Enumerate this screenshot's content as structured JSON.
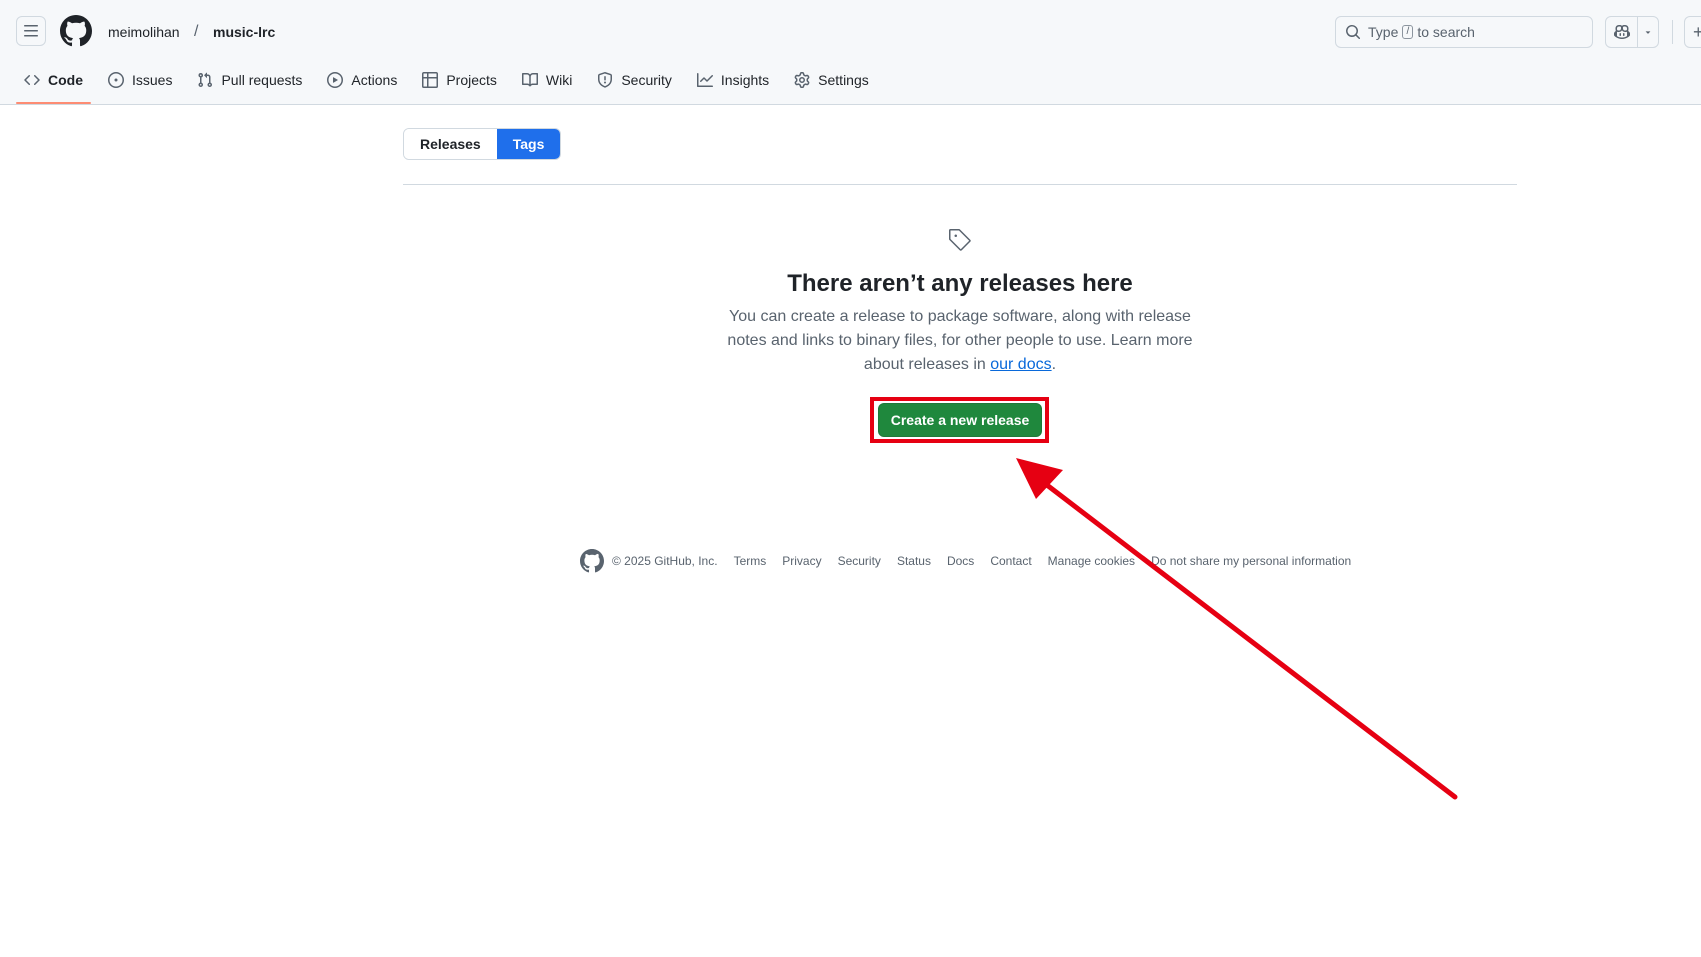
{
  "header": {
    "owner": "meimolihan",
    "separator": "/",
    "repo": "music-lrc",
    "search": {
      "prefix": "Type",
      "key": "/",
      "suffix": "to search"
    },
    "plus": "+"
  },
  "repo_nav": [
    {
      "label": "Code",
      "icon": "code-icon",
      "selected": true
    },
    {
      "label": "Issues",
      "icon": "issue-opened-icon"
    },
    {
      "label": "Pull requests",
      "icon": "git-pull-request-icon"
    },
    {
      "label": "Actions",
      "icon": "play-icon"
    },
    {
      "label": "Projects",
      "icon": "table-icon"
    },
    {
      "label": "Wiki",
      "icon": "book-icon"
    },
    {
      "label": "Security",
      "icon": "shield-icon"
    },
    {
      "label": "Insights",
      "icon": "graph-icon"
    },
    {
      "label": "Settings",
      "icon": "gear-icon"
    }
  ],
  "tabs": {
    "releases": "Releases",
    "tags": "Tags",
    "active": "Tags"
  },
  "blankslate": {
    "icon": "tag-icon",
    "title": "There aren’t any releases here",
    "text_line1": "You can create a release to package software, along with release",
    "text_line2": "notes and links to binary files, for other people to use. Learn more",
    "text_line3_prefix": "about releases in",
    "docs_link": "our docs",
    "text_line3_suffix": ".",
    "button": "Create a new release"
  },
  "footer": {
    "copyright": "© 2025 GitHub, Inc.",
    "links": [
      "Terms",
      "Privacy",
      "Security",
      "Status",
      "Docs",
      "Contact",
      "Manage cookies",
      "Do not share my personal information"
    ]
  },
  "colors": {
    "primary_button": "#1f883d",
    "selected_tab": "#1f6feb",
    "nav_underline": "#fd8c73",
    "annotation_red": "#e60012",
    "link": "#0969da"
  }
}
